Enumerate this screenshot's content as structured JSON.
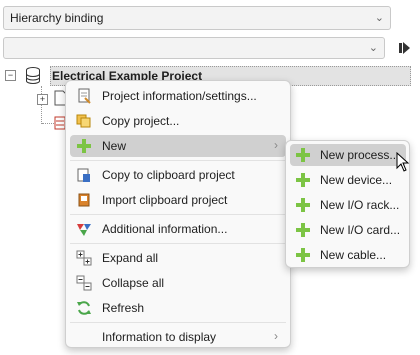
{
  "toolbar": {
    "view_select": {
      "value": "Hierarchy binding"
    },
    "filter_select": {
      "value": ""
    }
  },
  "tree": {
    "root_label": "Electrical Example Project"
  },
  "context_menu": {
    "items": [
      {
        "label": "Project information/settings...",
        "icon": "settings-icon"
      },
      {
        "label": "Copy project...",
        "icon": "copy-project-icon"
      },
      {
        "label": "New",
        "icon": "plus-icon",
        "submenu": "›"
      },
      {
        "label": "Copy to clipboard project",
        "icon": "clipboard-icon"
      },
      {
        "label": "Import clipboard project",
        "icon": "import-icon"
      },
      {
        "label": "Additional information...",
        "icon": "additional-info-icon"
      },
      {
        "label": "Expand all",
        "icon": "expand-all-icon"
      },
      {
        "label": "Collapse all",
        "icon": "collapse-all-icon"
      },
      {
        "label": "Refresh",
        "icon": "refresh-icon"
      },
      {
        "label": "Information to display",
        "icon": "",
        "submenu": "›"
      }
    ]
  },
  "new_submenu": {
    "items": [
      {
        "label": "New process...",
        "icon": "plus-icon"
      },
      {
        "label": "New device...",
        "icon": "plus-icon"
      },
      {
        "label": "New I/O rack...",
        "icon": "plus-icon"
      },
      {
        "label": "New I/O card...",
        "icon": "plus-icon"
      },
      {
        "label": "New cable...",
        "icon": "plus-icon"
      }
    ]
  },
  "colors": {
    "accent_plus": "#7cc444",
    "highlight": "#d0d0d0",
    "menu_bg": "#f9f9f9"
  }
}
